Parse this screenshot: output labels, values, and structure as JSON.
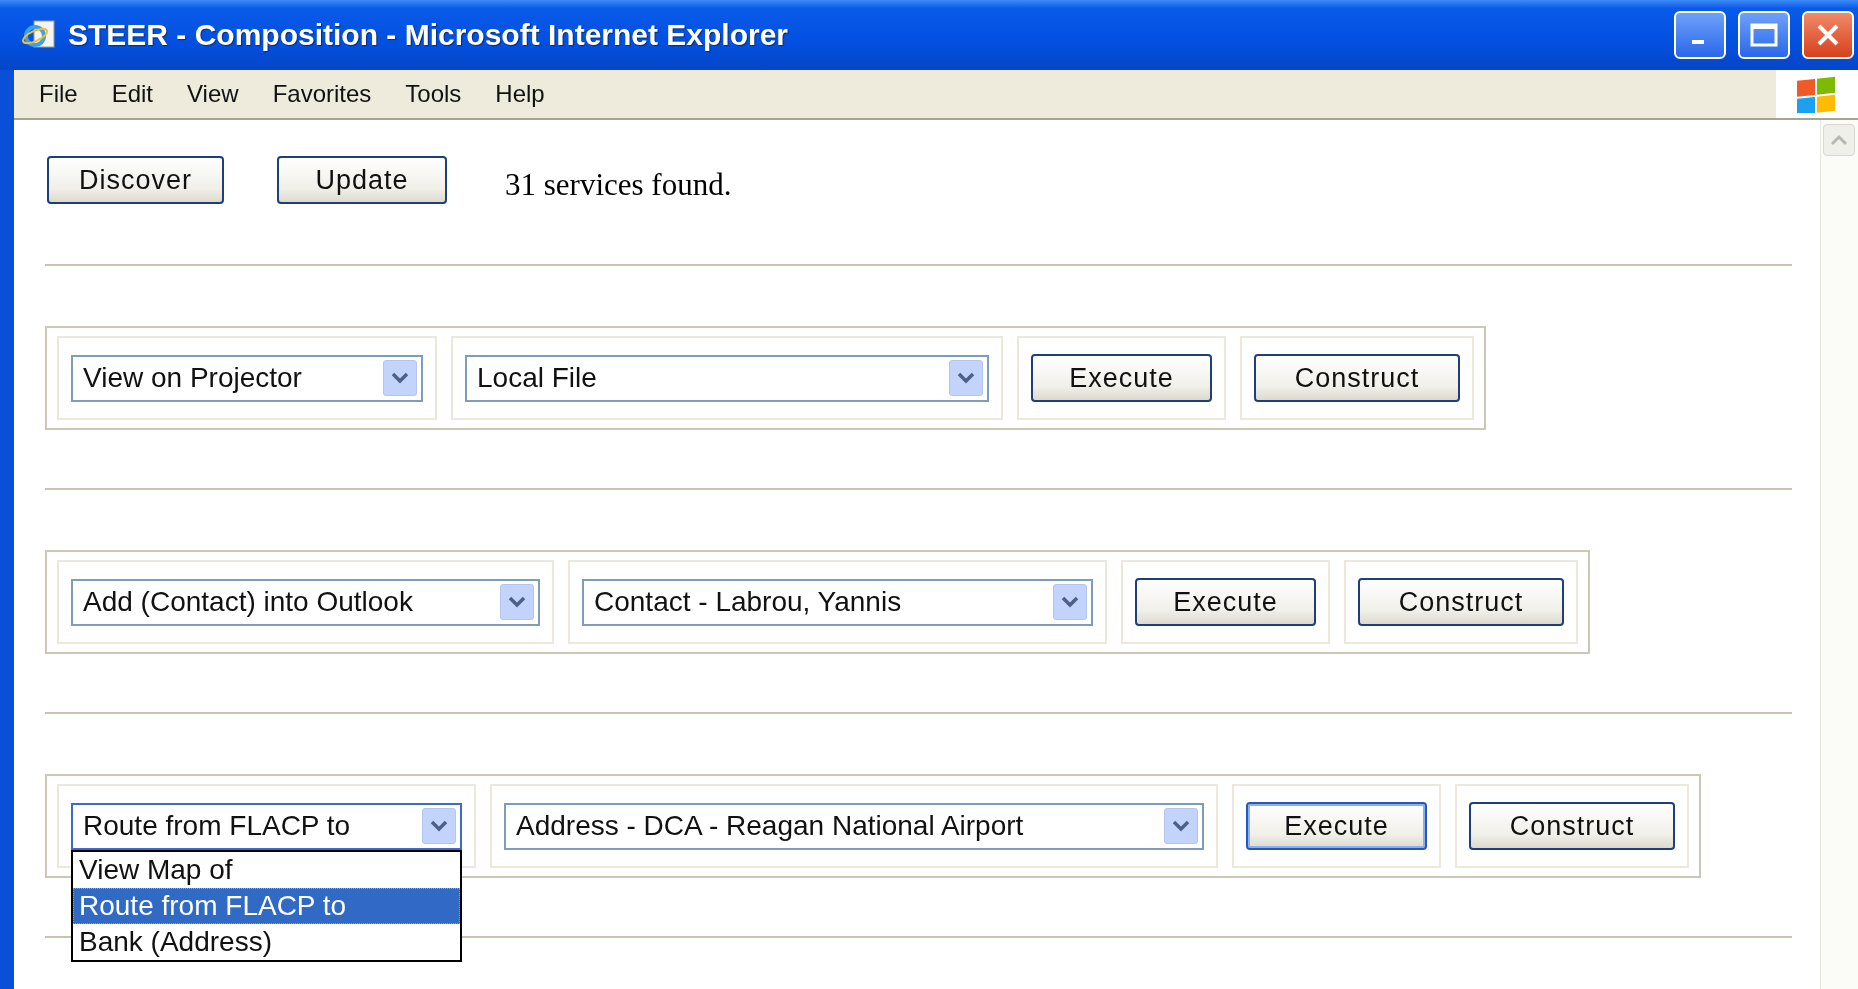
{
  "window": {
    "title": "STEER - Composition - Microsoft Internet Explorer"
  },
  "menu": [
    "File",
    "Edit",
    "View",
    "Favorites",
    "Tools",
    "Help"
  ],
  "toolbar": {
    "buttons": [
      "Discover",
      "Update"
    ],
    "status": "31 services found."
  },
  "rows": [
    {
      "service": {
        "value": "View on Projector",
        "open": false
      },
      "resource": {
        "value": "Local File"
      },
      "buttons": [
        {
          "label": "Execute",
          "focused": false
        },
        {
          "label": "Construct",
          "focused": false
        }
      ]
    },
    {
      "service": {
        "value": "Add (Contact) into Outlook",
        "open": false
      },
      "resource": {
        "value": "Contact - Labrou, Yannis"
      },
      "buttons": [
        {
          "label": "Execute",
          "focused": false
        },
        {
          "label": "Construct",
          "focused": false
        }
      ]
    },
    {
      "service": {
        "value": "Route from FLACP to",
        "open": true,
        "options": [
          {
            "label": "View Map of",
            "selected": false
          },
          {
            "label": "Route from FLACP to",
            "selected": true
          },
          {
            "label": "Bank (Address)",
            "selected": false
          }
        ]
      },
      "resource": {
        "value": "Address - DCA - Reagan National Airport"
      },
      "buttons": [
        {
          "label": "Execute",
          "focused": true
        },
        {
          "label": "Construct",
          "focused": false
        }
      ]
    }
  ]
}
